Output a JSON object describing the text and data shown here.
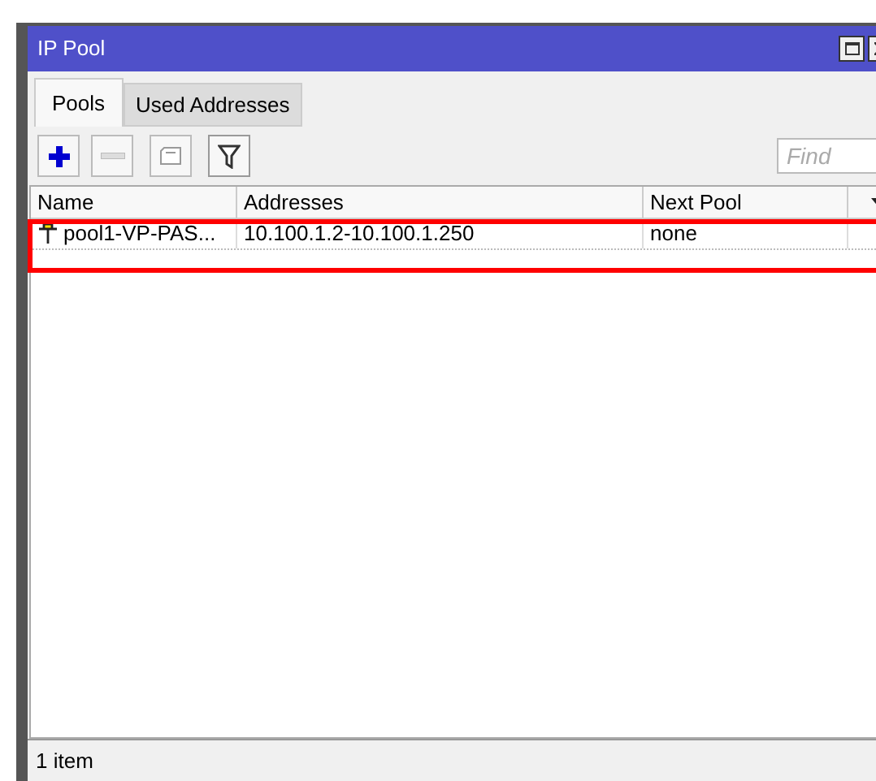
{
  "window": {
    "title": "IP Pool"
  },
  "tabs": [
    {
      "label": "Pools",
      "selected": true
    },
    {
      "label": "Used Addresses",
      "selected": false
    }
  ],
  "toolbar": {
    "add_enabled": true,
    "remove_enabled": false
  },
  "search": {
    "placeholder": "Find"
  },
  "table": {
    "columns": [
      "Name",
      "Addresses",
      "Next Pool"
    ],
    "rows": [
      {
        "cells": [
          "pool1-VP-PAS...",
          "10.100.1.2-10.100.1.250",
          "none"
        ],
        "selected": false
      }
    ]
  },
  "status_bar": "1 item"
}
